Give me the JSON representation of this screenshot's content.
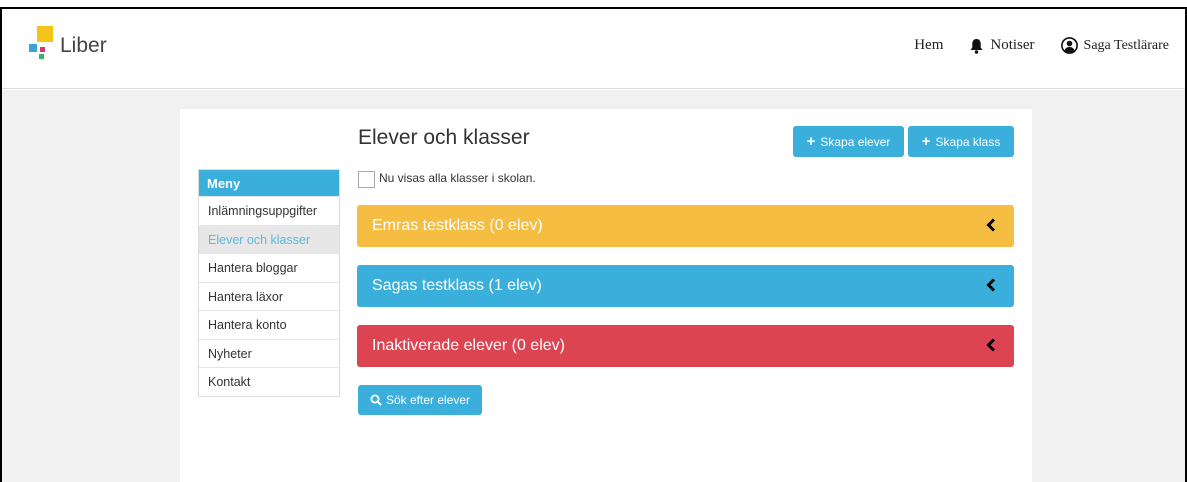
{
  "header": {
    "logo_text": "Liber",
    "nav": {
      "home": "Hem",
      "notifications": "Notiser",
      "user": "Saga Testlärare"
    },
    "icons": [
      "bell-icon",
      "user-circle-icon"
    ]
  },
  "sidebar": {
    "heading": "Meny",
    "items": [
      {
        "label": "Inlämningsuppgifter"
      },
      {
        "label": "Elever och klasser"
      },
      {
        "label": "Hantera bloggar"
      },
      {
        "label": "Hantera läxor"
      },
      {
        "label": "Hantera konto"
      },
      {
        "label": "Nyheter"
      },
      {
        "label": "Kontakt"
      }
    ],
    "active_index": 1
  },
  "main": {
    "title": "Elever och klasser",
    "create_students_label": "Skapa elever",
    "create_class_label": "Skapa klass",
    "show_all_label": "Nu visas alla klasser i skolan.",
    "panels": [
      {
        "label": "Emras testklass (0 elev)",
        "color": "#f6bd43"
      },
      {
        "label": "Sagas testklass (1 elev)",
        "color": "#3aafdb"
      },
      {
        "label": "Inaktiverade elever (0 elev)",
        "color": "#dc4452"
      }
    ],
    "search_label": "Sök efter elever"
  },
  "colors": {
    "accent": "#3aafdb",
    "yellow": "#f6bd43",
    "red": "#dc4452",
    "background": "#f1f1f1"
  }
}
